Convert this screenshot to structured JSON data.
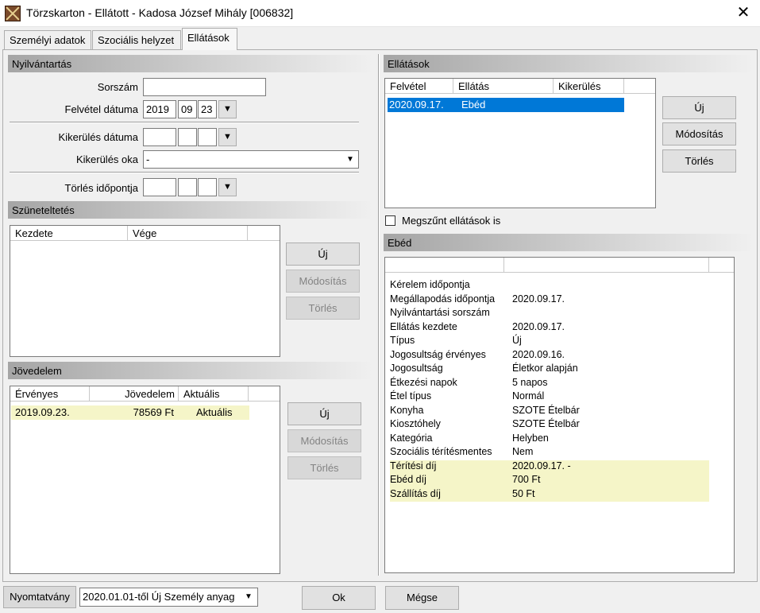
{
  "window": {
    "title": "Törzskarton - Ellátott - Kadosa József Mihály [006832]",
    "close_glyph": "✕"
  },
  "tabs": [
    {
      "label": "Személyi adatok"
    },
    {
      "label": "Szociális helyzet"
    },
    {
      "label": "Ellátások"
    }
  ],
  "nyilvantartas": {
    "header": "Nyilvántartás",
    "sorszam_label": "Sorszám",
    "sorszam_value": "",
    "felvetel_label": "Felvétel dátuma",
    "felvetel_year": "2019",
    "felvetel_month": "09",
    "felvetel_day": "23",
    "kikerules_label": "Kikerülés dátuma",
    "kikerules_oka_label": "Kikerülés oka",
    "kikerules_oka_value": "-",
    "torles_label": "Törlés időpontja"
  },
  "szuneteltetes": {
    "header": "Szüneteltetés",
    "columns": [
      "Kezdete",
      "Vége"
    ],
    "buttons": {
      "new": "Új",
      "modify": "Módosítás",
      "delete": "Törlés"
    }
  },
  "jovedelem": {
    "header": "Jövedelem",
    "columns": [
      "Érvényes",
      "Jövedelem",
      "Aktuális"
    ],
    "rows": [
      {
        "ervenyes": "2019.09.23.",
        "jovedelem": "78569 Ft",
        "aktualis": "Aktuális"
      }
    ],
    "buttons": {
      "new": "Új",
      "modify": "Módosítás",
      "delete": "Törlés"
    }
  },
  "ellatasok": {
    "header": "Ellátások",
    "columns": [
      "Felvétel",
      "Ellátás",
      "Kikerülés"
    ],
    "rows": [
      {
        "felvetel": "2020.09.17.",
        "ellatas": "Ebéd",
        "kikerules": ""
      }
    ],
    "buttons": {
      "new": "Új",
      "modify": "Módosítás",
      "delete": "Törlés"
    },
    "checkbox_label": "Megszűnt ellátások is"
  },
  "ebed": {
    "header": "Ebéd",
    "details": [
      {
        "k": "Kérelem időpontja",
        "v": ""
      },
      {
        "k": "Megállapodás időpontja",
        "v": "2020.09.17."
      },
      {
        "k": "Nyilvántartási sorszám",
        "v": ""
      },
      {
        "k": "Ellátás kezdete",
        "v": "2020.09.17."
      },
      {
        "k": "Típus",
        "v": "Új"
      },
      {
        "k": "Jogosultság érvényes",
        "v": "2020.09.16."
      },
      {
        "k": "Jogosultság",
        "v": "Életkor alapján"
      },
      {
        "k": "Étkezési napok",
        "v": "5 napos"
      },
      {
        "k": "Étel típus",
        "v": "Normál"
      },
      {
        "k": "Konyha",
        "v": "SZOTE Ételbár"
      },
      {
        "k": "Kiosztóhely",
        "v": "SZOTE Ételbár"
      },
      {
        "k": "Kategória",
        "v": "Helyben"
      },
      {
        "k": "Szociális térítésmentes",
        "v": "Nem"
      },
      {
        "k": "Térítési díj",
        "v": "2020.09.17. -"
      },
      {
        "k": "Ebéd díj",
        "v": "700 Ft"
      },
      {
        "k": "Szállítás díj",
        "v": "50 Ft"
      }
    ],
    "highlight_color": "#f5f5c8"
  },
  "bottom": {
    "print_label": "Nyomtatvány",
    "print_select_value": "2020.01.01-től Új Személy anyag",
    "ok": "Ok",
    "cancel": "Mégse"
  },
  "colors": {
    "selection": "#0078d7",
    "highlight_row": "#f5f5c8"
  }
}
